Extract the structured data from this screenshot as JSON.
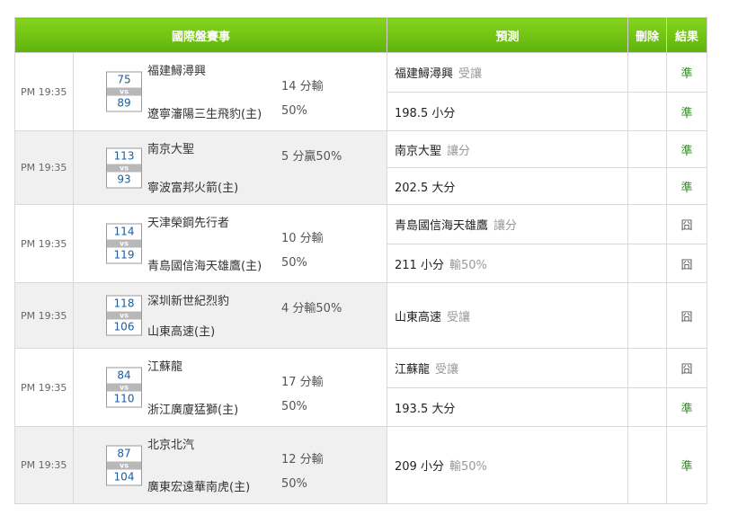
{
  "headers": {
    "event": "國際盤賽事",
    "prediction": "預測",
    "delete": "刪除",
    "result": "結果"
  },
  "matches": [
    {
      "time": "PM 19:35",
      "away_score": "75",
      "home_score": "89",
      "vs": "vs",
      "team1": "福建鱘潯興",
      "team2": "遼寧瀋陽三生飛豹(主)",
      "hc1": "14 分輸",
      "hc2": "50%",
      "preds": [
        {
          "main": "福建鱘潯興",
          "sub": "受讓",
          "result": "準"
        },
        {
          "main": "198.5 小分",
          "sub": "",
          "result": "準"
        }
      ]
    },
    {
      "time": "PM 19:35",
      "away_score": "113",
      "home_score": "93",
      "vs": "vs",
      "team1": "南京大聖",
      "team2": "寧波富邦火箭(主)",
      "hc1": "5 分贏50%",
      "hc2": "",
      "preds": [
        {
          "main": "南京大聖",
          "sub": "讓分",
          "result": "準"
        },
        {
          "main": "202.5 大分",
          "sub": "",
          "result": "準"
        }
      ]
    },
    {
      "time": "PM 19:35",
      "away_score": "114",
      "home_score": "119",
      "vs": "vs",
      "team1": "天津榮鋼先行者",
      "team2": "青島國信海天雄鷹(主)",
      "hc1": "10 分輸",
      "hc2": "50%",
      "preds": [
        {
          "main": "青島國信海天雄鷹",
          "sub": "讓分",
          "result": "囧"
        },
        {
          "main": "211 小分",
          "sub": "輸50%",
          "result": "囧"
        }
      ]
    },
    {
      "time": "PM 19:35",
      "away_score": "118",
      "home_score": "106",
      "vs": "vs",
      "team1": "深圳新世紀烈豹",
      "team2": "山東高速(主)",
      "hc1": "4 分輸50%",
      "hc2": "",
      "preds": [
        {
          "main": "山東高速",
          "sub": "受讓",
          "result": "囧"
        }
      ]
    },
    {
      "time": "PM 19:35",
      "away_score": "84",
      "home_score": "110",
      "vs": "vs",
      "team1": "江蘇龍",
      "team2": "浙江廣廈猛獅(主)",
      "hc1": "17 分輸",
      "hc2": "50%",
      "preds": [
        {
          "main": "江蘇龍",
          "sub": "受讓",
          "result": "囧"
        },
        {
          "main": "193.5 大分",
          "sub": "",
          "result": "準"
        }
      ]
    },
    {
      "time": "PM 19:35",
      "away_score": "87",
      "home_score": "104",
      "vs": "vs",
      "team1": "北京北汽",
      "team2": "廣東宏遠華南虎(主)",
      "hc1": "12 分輸",
      "hc2": "50%",
      "preds": [
        {
          "main": "209 小分",
          "sub": "輸50%",
          "result": "準"
        }
      ]
    }
  ]
}
